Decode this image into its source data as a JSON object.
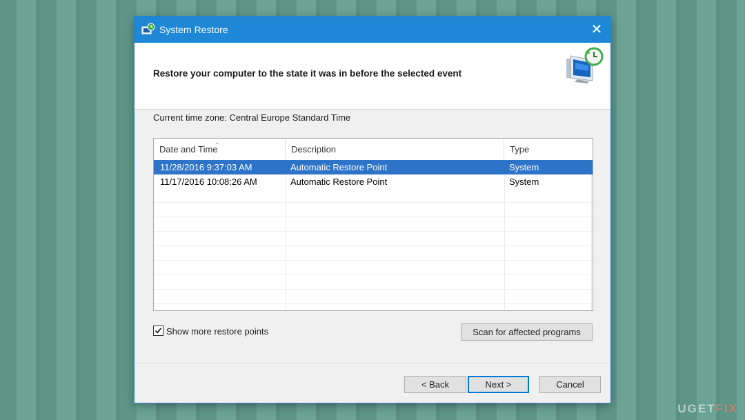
{
  "window": {
    "title": "System Restore",
    "close_glyph": "✕"
  },
  "header": {
    "heading": "Restore your computer to the state it was in before the selected event",
    "graphic_icon": "system-restore-icon"
  },
  "timezone_label": "Current time zone: Central Europe Standard Time",
  "restore_list": {
    "columns": [
      "Date and Time",
      "Description",
      "Type"
    ],
    "sort_glyph": "⌄",
    "rows": [
      {
        "date": "11/28/2016 9:37:03 AM",
        "description": "Automatic Restore Point",
        "type": "System",
        "selected": true
      },
      {
        "date": "11/17/2016 10:08:26 AM",
        "description": "Automatic Restore Point",
        "type": "System",
        "selected": false
      }
    ]
  },
  "show_more": {
    "label": "Show more restore points",
    "checked": true
  },
  "buttons": {
    "scan": "Scan for affected programs",
    "back": "< Back",
    "next": "Next >",
    "cancel": "Cancel"
  },
  "watermark": {
    "left": "UG",
    "middle": "ET",
    "right": "FIX"
  },
  "colors": {
    "titlebar": "#1e88d6",
    "selection": "#2d74c9",
    "default_button_border": "#0078d7"
  }
}
